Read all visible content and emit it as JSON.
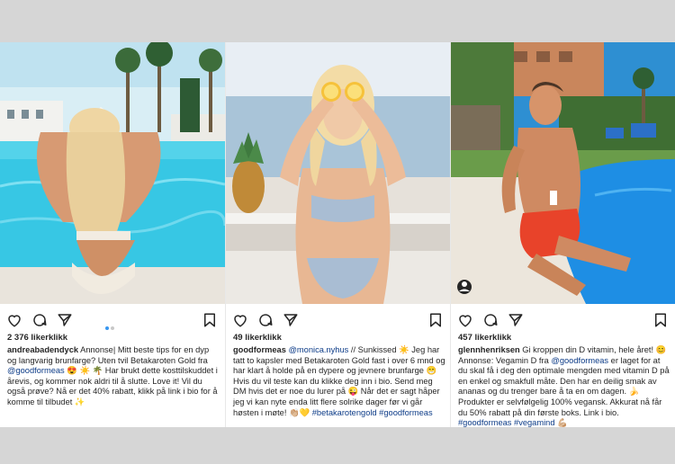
{
  "posts": [
    {
      "likes": "2 376 likerklikk",
      "user": "andreabadendyck",
      "text1": "Annonse| Mitt beste tips for en dyp og langvarig brunfarge? Uten tvil Betakaroten Gold fra ",
      "mention": "@goodformeas",
      "text2": " 😍 ☀️ 🌴 Har brukt dette kosttilskuddet i årevis, og kommer nok aldri til å slutte. Love it! Vil du også prøve? Nå er det 40% rabatt, klikk på link i bio for å komme til tilbudet ✨"
    },
    {
      "likes": "49 likerklikk",
      "user": "goodformeas",
      "mention": "@monica.nyhus",
      "text1": " // Sunkissed ☀️ Jeg har tatt to kapsler med Betakaroten Gold fast i over 6 mnd og har klart å holde på en dypere og jevnere brunfarge 😁 Hvis du vil teste kan du klikke deg inn i bio. Send meg DM hvis det er noe du lurer på 😜 Når det er sagt håper jeg vi kan nyte enda litt flere solrike dager før vi går høsten i møte! 👏🏼💛",
      "tags": "#betakarotengold #goodformeas"
    },
    {
      "likes": "457 likerklikk",
      "user": "glennhenriksen",
      "text1": " Gi kroppen din D vitamin, hele året! 😊 Annonse: Vegamin D fra ",
      "mention": "@goodformeas",
      "text2": " er laget for at du skal få i deg den optimale mengden med vitamin D på en enkel og smakfull måte. Den har en deilig smak av ananas og du trenger bare å ta en om dagen. 🍌 Produkter er selvfølgelig 100% vegansk. Akkurat nå får du 50% rabatt på din første boks. Link i bio. ",
      "tags": "#goodformeas #vegamind",
      "emoji_end": " 💪🏼"
    }
  ],
  "icons": [
    "heart-icon",
    "comment-icon",
    "share-icon",
    "bookmark-icon"
  ],
  "colors": {
    "link": "#0d3c88",
    "active_dot": "#3897f0",
    "pool": "#37c7e4"
  }
}
